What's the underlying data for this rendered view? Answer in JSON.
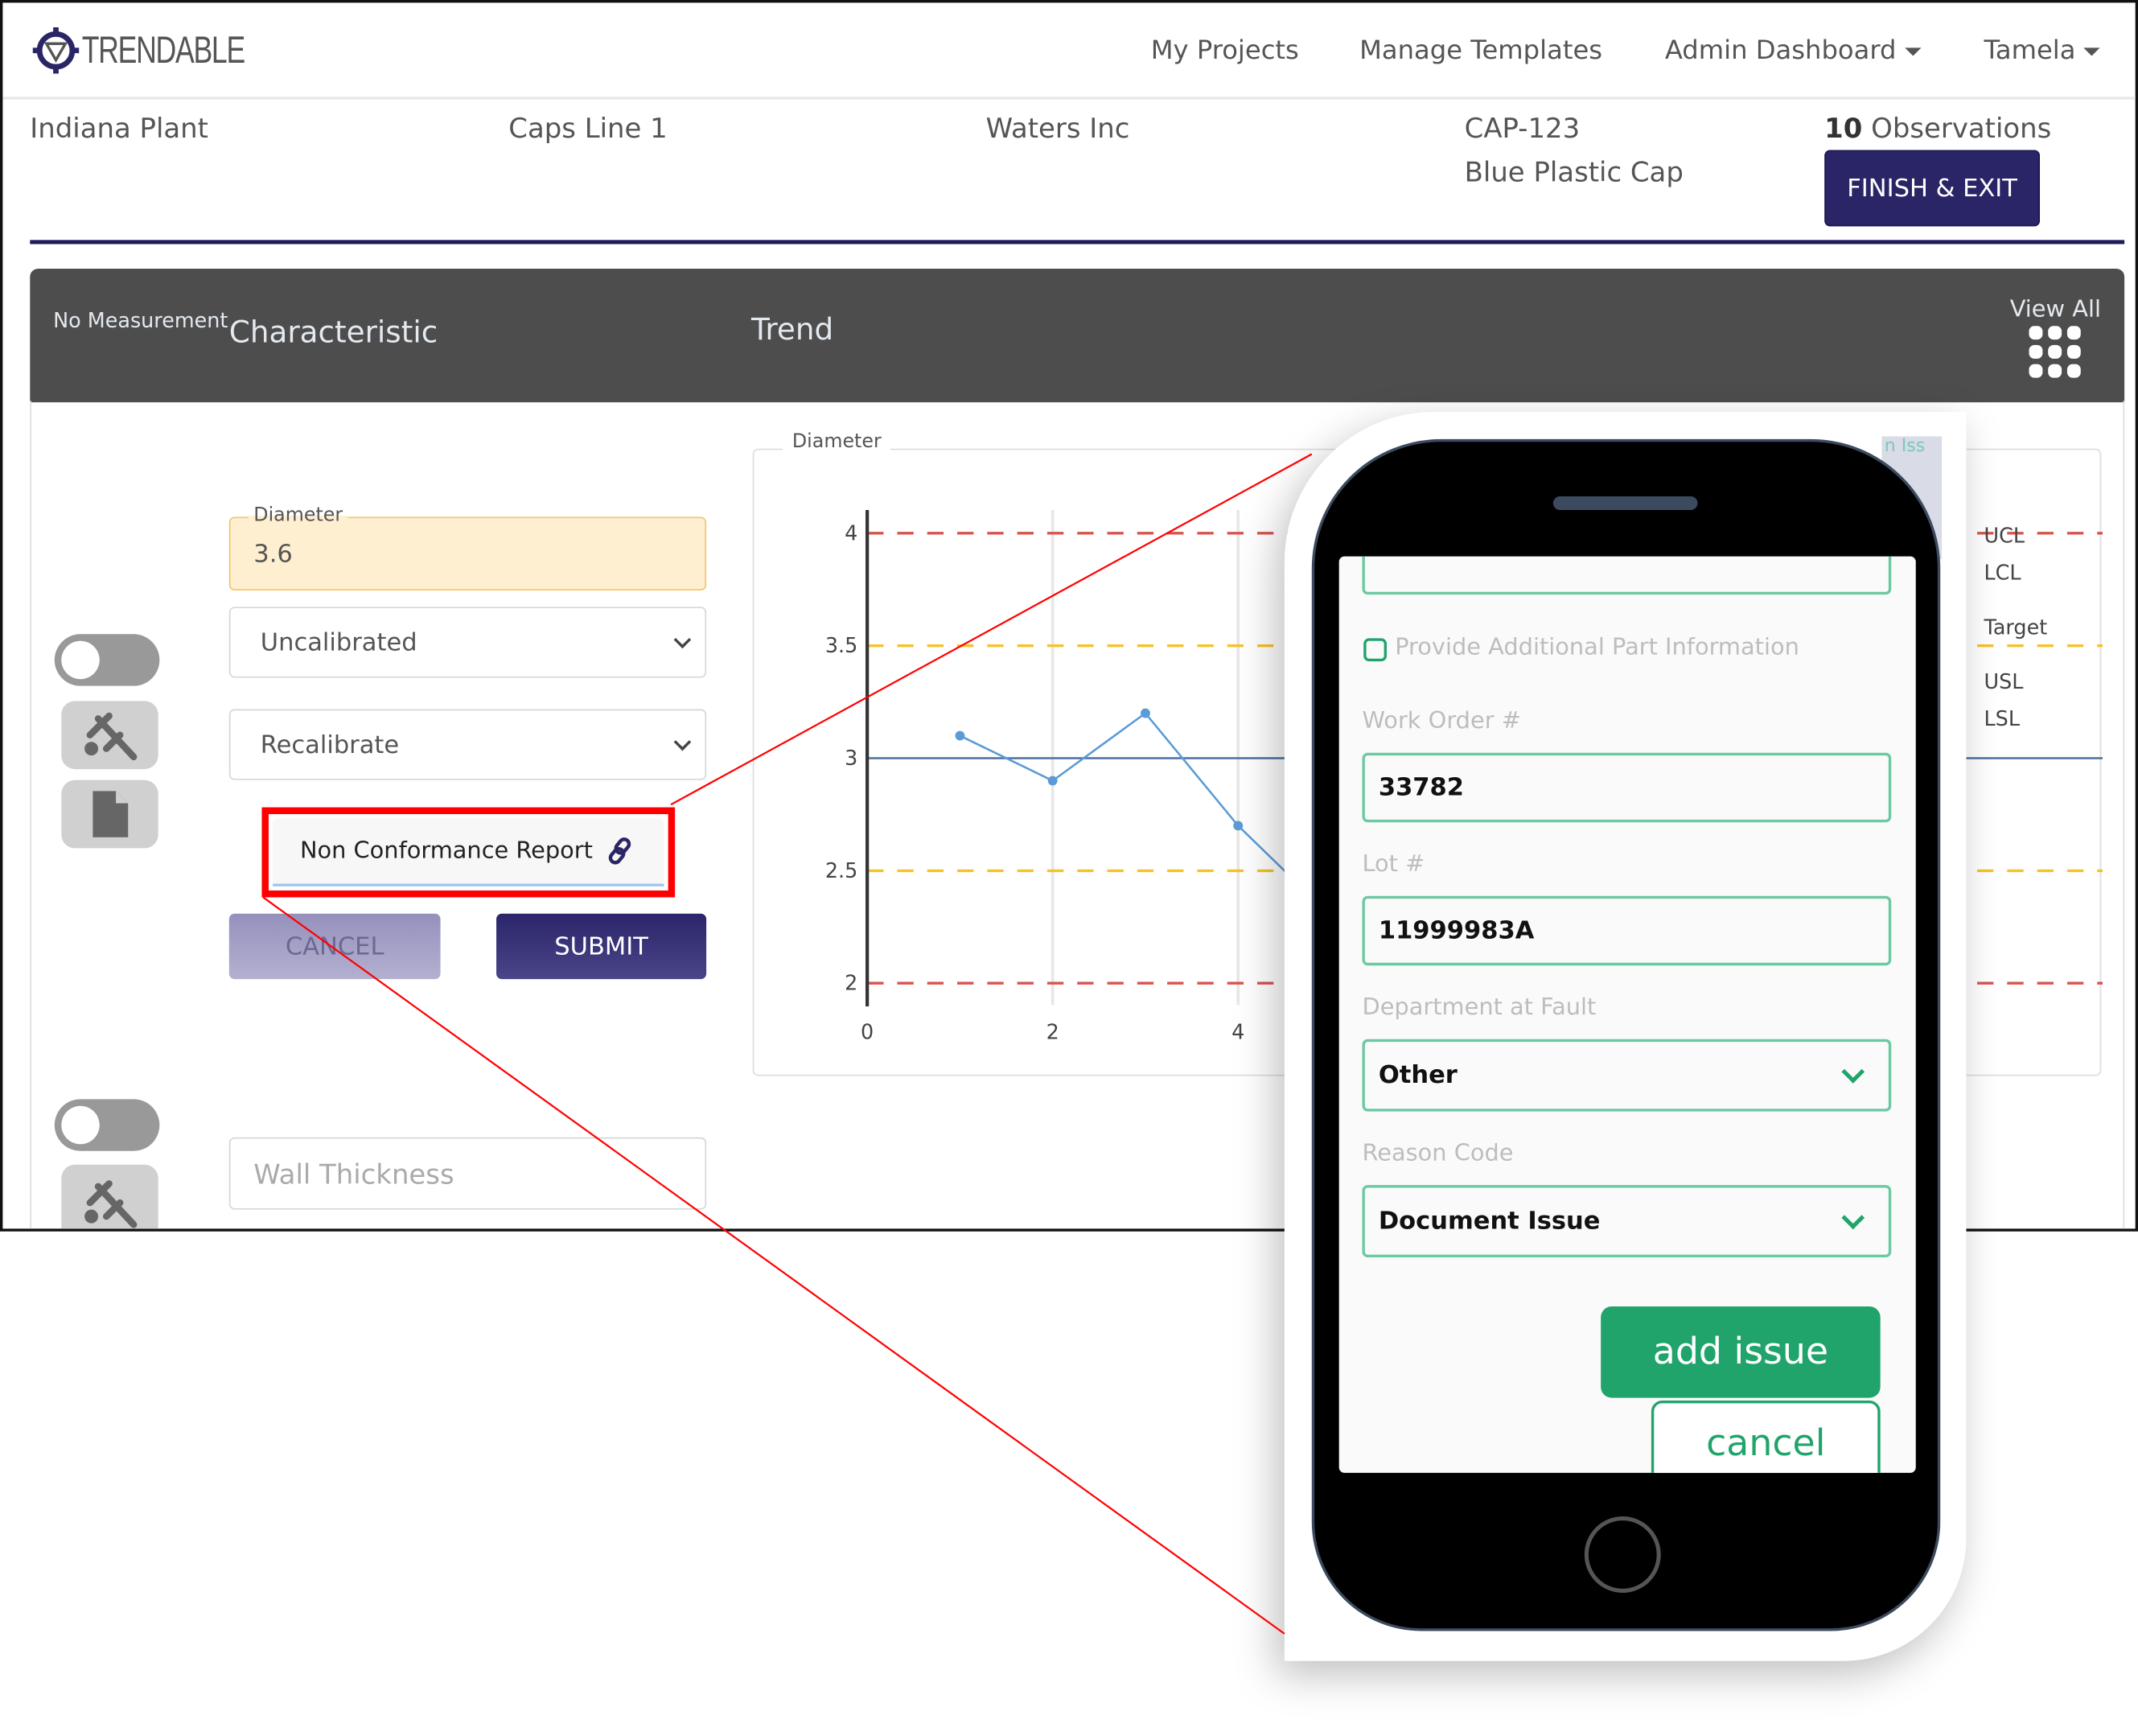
{
  "app": {
    "logo_text": "TRENDABLE"
  },
  "nav": {
    "items": [
      {
        "label": "My Projects"
      },
      {
        "label": "Manage Templates"
      },
      {
        "label": "Admin Dashboard"
      },
      {
        "label": "Tamela"
      }
    ]
  },
  "info": {
    "plant": "Indiana Plant",
    "line": "Caps Line 1",
    "customer": "Waters Inc",
    "part_number": "CAP-123",
    "part_name": "Blue Plastic Cap",
    "observations_count": "10",
    "observations_label": "Observations",
    "finish_label": "FINISH & EXIT"
  },
  "table_header": {
    "no_measurement": "No Measurement",
    "characteristic": "Characteristic",
    "trend": "Trend",
    "view_all": "View All"
  },
  "row1": {
    "field_label": "Diameter",
    "value": "3.6",
    "calibration_select": "Uncalibrated",
    "action_select": "Recalibrate",
    "ncr_label": "Non Conformance Report",
    "cancel_label": "CANCEL",
    "submit_label": "SUBMIT"
  },
  "row2": {
    "placeholder": "Wall Thickness"
  },
  "chart_data": {
    "type": "line",
    "title": "Diameter",
    "x": [
      1,
      2,
      3,
      4,
      5
    ],
    "values": [
      3.1,
      2.9,
      3.2,
      2.7,
      2.3
    ],
    "xlim": [
      0,
      5
    ],
    "ylim": [
      1.9,
      4.1
    ],
    "x_ticks": [
      "0",
      "2",
      "4"
    ],
    "y_ticks": [
      "4",
      "3.5",
      "3",
      "2.5",
      "2"
    ],
    "reference_lines": [
      {
        "name": "UCL",
        "value": 4,
        "color": "#d9534f",
        "style": "dashed"
      },
      {
        "name": "USL",
        "value": 3.5,
        "color": "#f5c22b",
        "style": "dashed"
      },
      {
        "name": "Target",
        "value": 3,
        "color": "#4a6fa0",
        "style": "solid"
      },
      {
        "name": "LSL",
        "value": 2.5,
        "color": "#f5c22b",
        "style": "dashed"
      },
      {
        "name": "LCL",
        "value": 2,
        "color": "#d9534f",
        "style": "dashed"
      }
    ],
    "legend": [
      "UCL",
      "LCL",
      "Target",
      "USL",
      "LSL"
    ],
    "legend_placement": "right",
    "series_color": "#5b9bd5",
    "grid": true
  },
  "phone": {
    "corner_text": "n Iss",
    "checkbox_label": "Provide Additional Part Information",
    "work_order_label": "Work Order #",
    "work_order_value": "33782",
    "lot_label": "Lot #",
    "lot_value": "11999983A",
    "department_label": "Department at Fault",
    "department_value": "Other",
    "reason_label": "Reason Code",
    "reason_value": "Document Issue",
    "add_issue_label": "add issue",
    "cancel_label": "cancel"
  },
  "colors": {
    "brand": "#2a2566",
    "accent_green": "#21a46b",
    "highlight_red": "#ff0000",
    "header_band": "#4d4d4d",
    "field_highlight": "#fdefd0"
  }
}
